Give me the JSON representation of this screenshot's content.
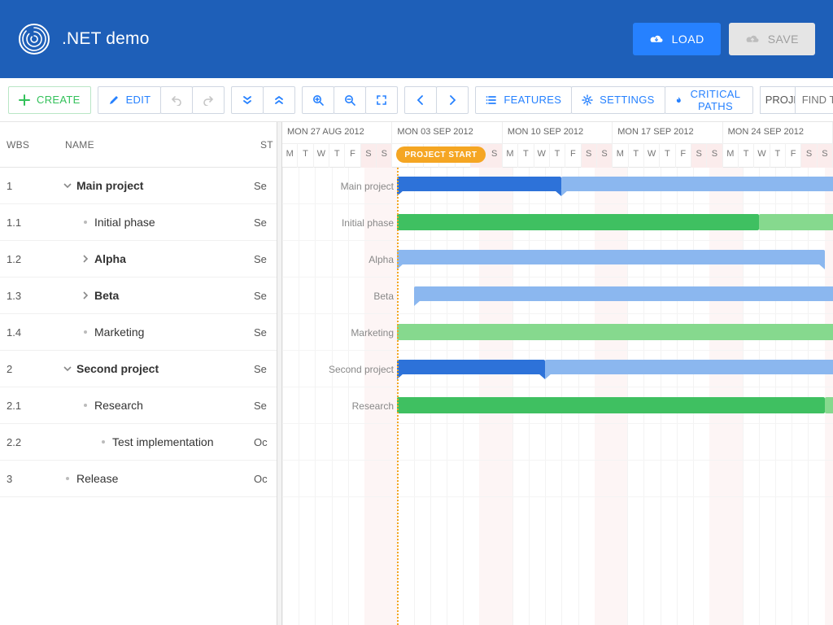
{
  "appTitle": ".NET demo",
  "header": {
    "load": "LOAD",
    "save": "SAVE"
  },
  "toolbar": {
    "create": "CREATE",
    "edit": "EDIT",
    "features": "FEATURES",
    "settings": "SETTINGS",
    "critical": "CRITICAL PATHS",
    "projectSelect": "PROJE",
    "findPlaceholder": "FIND TASKS B"
  },
  "columns": {
    "wbs": "WBS",
    "name": "NAME",
    "start": "ST"
  },
  "projectStartLabel": "PROJECT START",
  "dayLetters": [
    "M",
    "T",
    "W",
    "T",
    "F",
    "S",
    "S"
  ],
  "weeks": [
    "MON 27 AUG 2012",
    "MON 03 SEP 2012",
    "MON 10 SEP 2012",
    "MON 17 SEP 2012",
    "MON 24 SEP 2012"
  ],
  "tasks": [
    {
      "wbs": "1",
      "name": "Main project",
      "indent": 0,
      "kind": "parent-open",
      "st": "Se"
    },
    {
      "wbs": "1.1",
      "name": "Initial phase",
      "indent": 1,
      "kind": "leaf",
      "st": "Se"
    },
    {
      "wbs": "1.2",
      "name": "Alpha",
      "indent": 1,
      "kind": "parent-closed",
      "st": "Se"
    },
    {
      "wbs": "1.3",
      "name": "Beta",
      "indent": 1,
      "kind": "parent-closed",
      "st": "Se"
    },
    {
      "wbs": "1.4",
      "name": "Marketing",
      "indent": 1,
      "kind": "leaf",
      "st": "Se"
    },
    {
      "wbs": "2",
      "name": "Second project",
      "indent": 0,
      "kind": "parent-open",
      "st": "Se"
    },
    {
      "wbs": "2.1",
      "name": "Research",
      "indent": 1,
      "kind": "leaf",
      "st": "Se"
    },
    {
      "wbs": "2.2",
      "name": "Test implementation",
      "indent": 2,
      "kind": "leaf",
      "st": "Oc"
    },
    {
      "wbs": "3",
      "name": "Release",
      "indent": 0,
      "kind": "leaf",
      "st": "Oc"
    }
  ],
  "chart_data": {
    "type": "gantt",
    "dayWidthPx": 20.2,
    "labelGutterPx": 143,
    "timelineStart": "2012-08-27",
    "projectStart": "2012-09-03",
    "weekendDayIndices": [
      5,
      6
    ],
    "rows": [
      {
        "label": "Main project",
        "bars": [
          {
            "style": "summary-blue",
            "startDay": 7,
            "spanDays": 10
          },
          {
            "style": "summary-light",
            "startDay": 17,
            "spanDays": 20
          }
        ]
      },
      {
        "label": "Initial phase",
        "bars": [
          {
            "style": "task-green",
            "startDay": 7,
            "spanDays": 22
          },
          {
            "style": "task-light",
            "startDay": 29,
            "spanDays": 8
          }
        ]
      },
      {
        "label": "Alpha",
        "bars": [
          {
            "style": "summary-light",
            "startDay": 7,
            "spanDays": 26
          }
        ]
      },
      {
        "label": "Beta",
        "bars": [
          {
            "style": "summary-light",
            "startDay": 8,
            "spanDays": 29
          }
        ]
      },
      {
        "label": "Marketing",
        "bars": [
          {
            "style": "task-light",
            "startDay": 7,
            "spanDays": 30
          }
        ]
      },
      {
        "label": "Second project",
        "bars": [
          {
            "style": "summary-blue",
            "startDay": 7,
            "spanDays": 9
          },
          {
            "style": "summary-light",
            "startDay": 16,
            "spanDays": 21
          }
        ]
      },
      {
        "label": "Research",
        "bars": [
          {
            "style": "task-green",
            "startDay": 7,
            "spanDays": 26
          },
          {
            "style": "task-light",
            "startDay": 33,
            "spanDays": 4
          }
        ]
      }
    ]
  }
}
